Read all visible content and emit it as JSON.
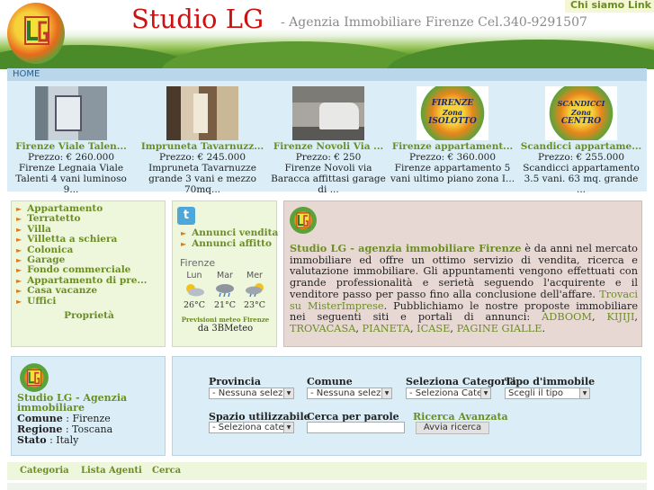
{
  "header": {
    "title": "Studio LG",
    "subtitle": "- Agenzia Immobiliare Firenze Cel.340-9291507",
    "chi_siamo": "Chi siamo Link"
  },
  "nav": {
    "home": "HOME"
  },
  "listings": [
    {
      "title": "Firenze Viale Talen...",
      "price": "Prezzo:  € 260.000",
      "desc": "Firenze Legnaia Viale Talenti 4 vani luminoso 9...",
      "image": "room-photo"
    },
    {
      "title": "Impruneta Tavarnuzz...",
      "price": "Prezzo:  € 245.000",
      "desc": "Impruneta Tavarnuzze grande 3 vani e mezzo 70mq...",
      "image": "room-photo"
    },
    {
      "title": "Firenze Novoli Via ...",
      "price": "Prezzo:  € 250",
      "desc": "Firenze Novoli via Baracca affittasi garage di ...",
      "image": "garage-photo"
    },
    {
      "title": "Firenze appartament...",
      "price": "Prezzo:  € 360.000",
      "desc": "Firenze appartamento 5 vani ultimo piano zona I...",
      "image": "zone-logo",
      "badge": [
        "FIRENZE",
        "Zona",
        "ISOLOTTO"
      ]
    },
    {
      "title": "Scandicci appartame...",
      "price": "Prezzo:  € 255.000",
      "desc": "Scandicci appartamento 3.5 vani. 63 mq. grande ...",
      "image": "zone-logo",
      "badge": [
        "SCANDICCI",
        "Zona",
        "CENTRO"
      ]
    }
  ],
  "categories": {
    "items": [
      "Appartamento",
      "Terratetto",
      "Villa",
      "Villetta a schiera",
      "Colonica",
      "Garage",
      "Fondo commerciale",
      "Appartamento di pre...",
      "Casa vacanze",
      "Uffici"
    ],
    "footer": "Proprietà"
  },
  "annunci": {
    "vendita": "Annunci vendita",
    "affitto": "Annunci affitto"
  },
  "weather": {
    "city": "Firenze",
    "days": [
      {
        "day": "Lun",
        "temp": "26°C",
        "icon": "sun-cloud-icon"
      },
      {
        "day": "Mar",
        "temp": "21°C",
        "icon": "rain-cloud-icon"
      },
      {
        "day": "Mer",
        "temp": "23°C",
        "icon": "sun-rain-icon"
      }
    ],
    "caption": "Previsioni meteo Firenze",
    "source": "da 3BMeteo"
  },
  "info": {
    "brand": "Studio LG - agenzia immobiliare Firenze",
    "text1": " è da anni nel mercato immobiliare ed offre un ottimo servizio di vendita, ricerca e valutazione immobiliare. Gli appuntamenti vengono effettuati con grande professionalità e serietà seguendo l'acquirente e il venditore passo per passo fino alla conclusione dell'affare. ",
    "link_mi": "Trovaci su MisterImprese",
    "text2": ". Pubblichiamo le nostre proposte immobiliare nei seguenti siti e portali di annunci: ",
    "portals": [
      "ADBOOM",
      "KIJIJI",
      "TROVACASA",
      "PIANETA",
      "ICASE",
      "PAGINE GIALLE"
    ]
  },
  "agency": {
    "name": "Studio LG - Agenzia immobiliare",
    "comune_label": "Comune",
    "comune": "Firenze",
    "regione_label": "Regione",
    "regione": "Toscana",
    "stato_label": "Stato",
    "stato": "Italy"
  },
  "search": {
    "provincia_label": "Provincia",
    "provincia_value": "- Nessuna selez",
    "comune_label": "Comune",
    "comune_value": "- Nessuna selez",
    "categoria_label": "Seleziona Categoria",
    "categoria_value": "- Seleziona Cate",
    "tipo_label": "Tipo d'immobile",
    "tipo_value": "Scegli il tipo",
    "spazio_label": "Spazio utilizzabile",
    "spazio_value": "- Seleziona cate",
    "parole_label": "Cerca per parole",
    "avanzata": "Ricerca Avanzata",
    "button": "Avvia ricerca"
  },
  "footer": {
    "links": [
      "Categoria",
      "Lista Agenti",
      "Cerca"
    ]
  },
  "colors": {
    "accent_green": "#6b8e23",
    "title_red": "#cc1111",
    "panel_blue": "#dbeef7",
    "panel_green": "#eef6dc",
    "panel_rose": "#e8d8d4"
  }
}
